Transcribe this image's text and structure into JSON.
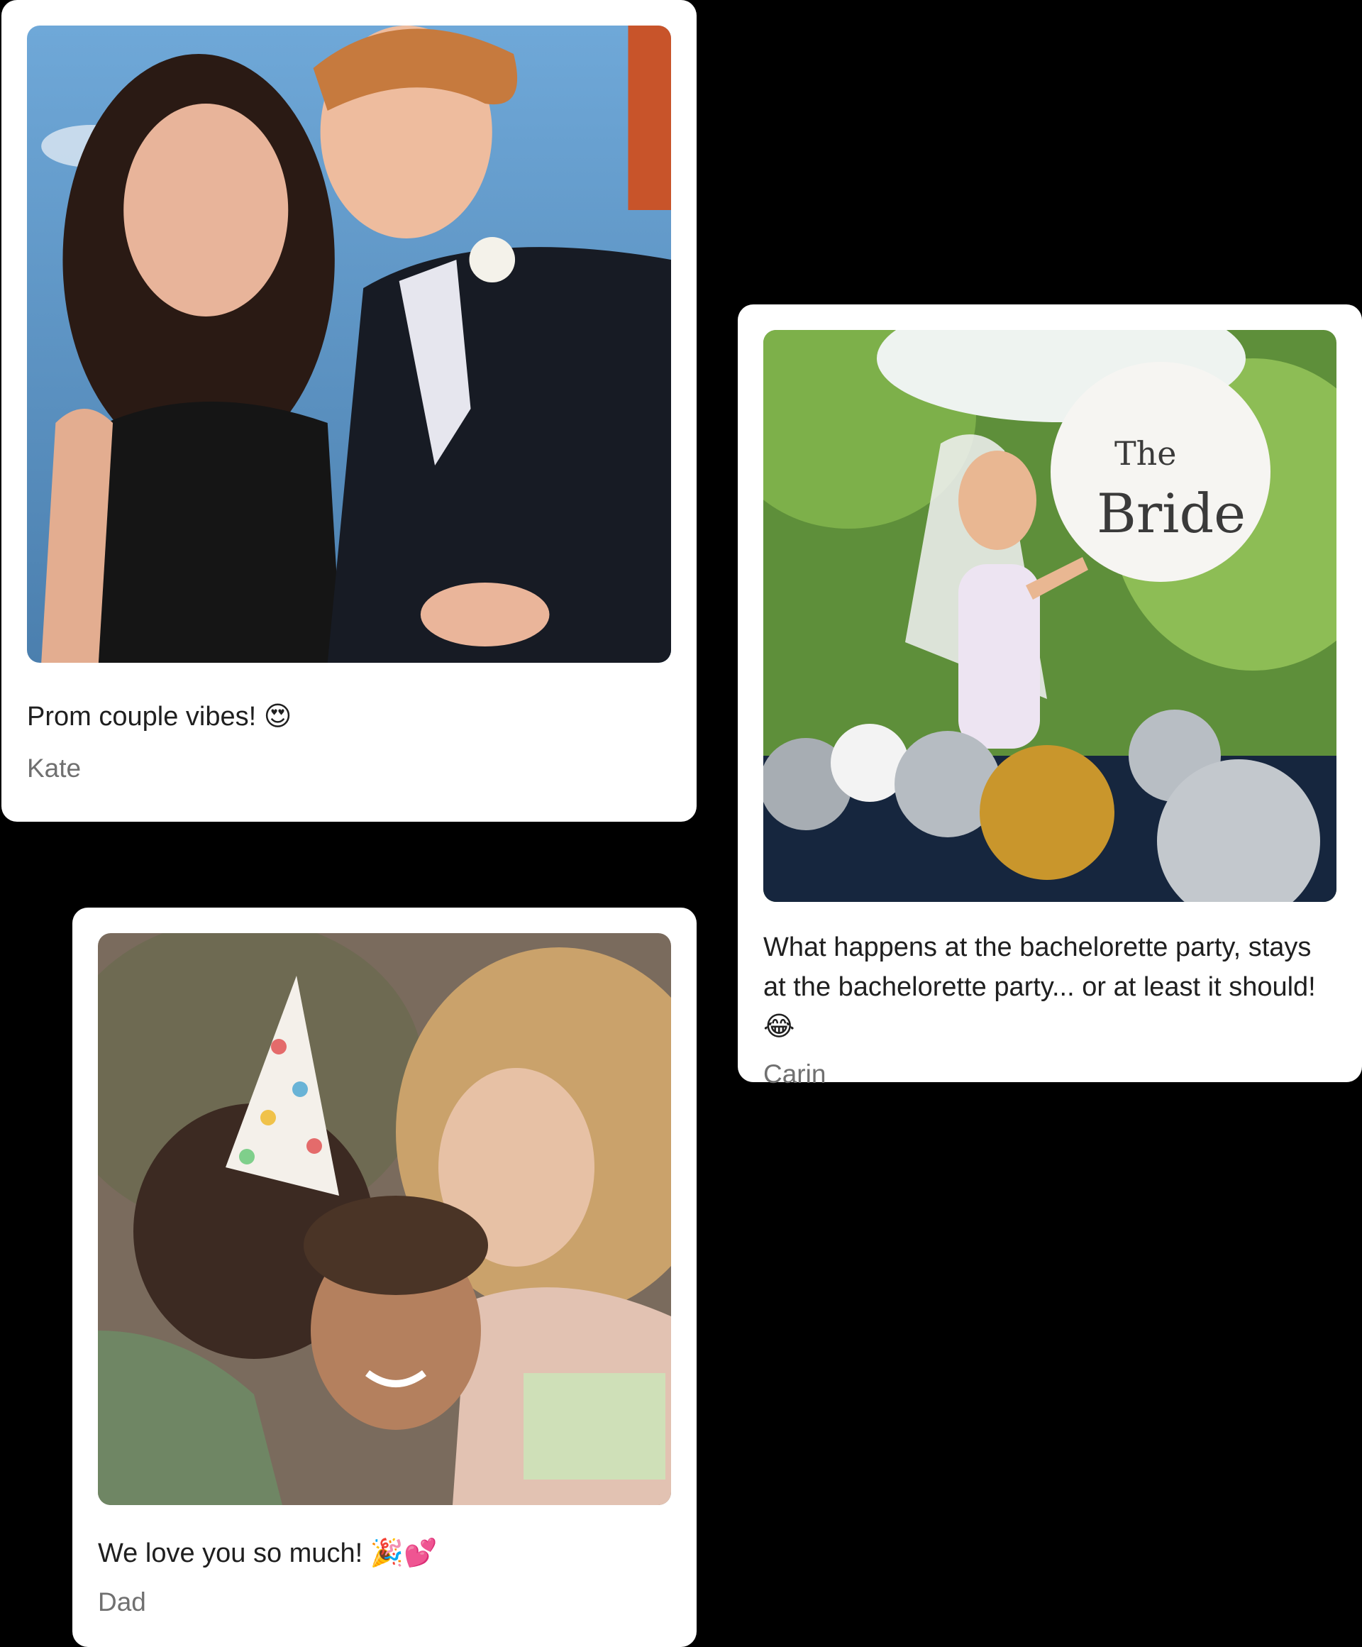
{
  "cards": [
    {
      "caption": "Prom couple vibes! 😍",
      "author": "Kate",
      "photo_icon": "prom-couple-photo"
    },
    {
      "caption": "What happens at the bachelorette party, stays at the bachelorette party... or at least it should! 😂",
      "author": "Carin",
      "photo_icon": "bachelorette-photo",
      "balloon_text_top": "The",
      "balloon_text_bottom": "Bride"
    },
    {
      "caption": "We love you so much! 🎉💕",
      "author": "Dad",
      "photo_icon": "birthday-family-photo"
    }
  ],
  "colors": {
    "background": "#000000",
    "card": "#ffffff",
    "caption": "#1f1f1f",
    "author": "#707070"
  }
}
